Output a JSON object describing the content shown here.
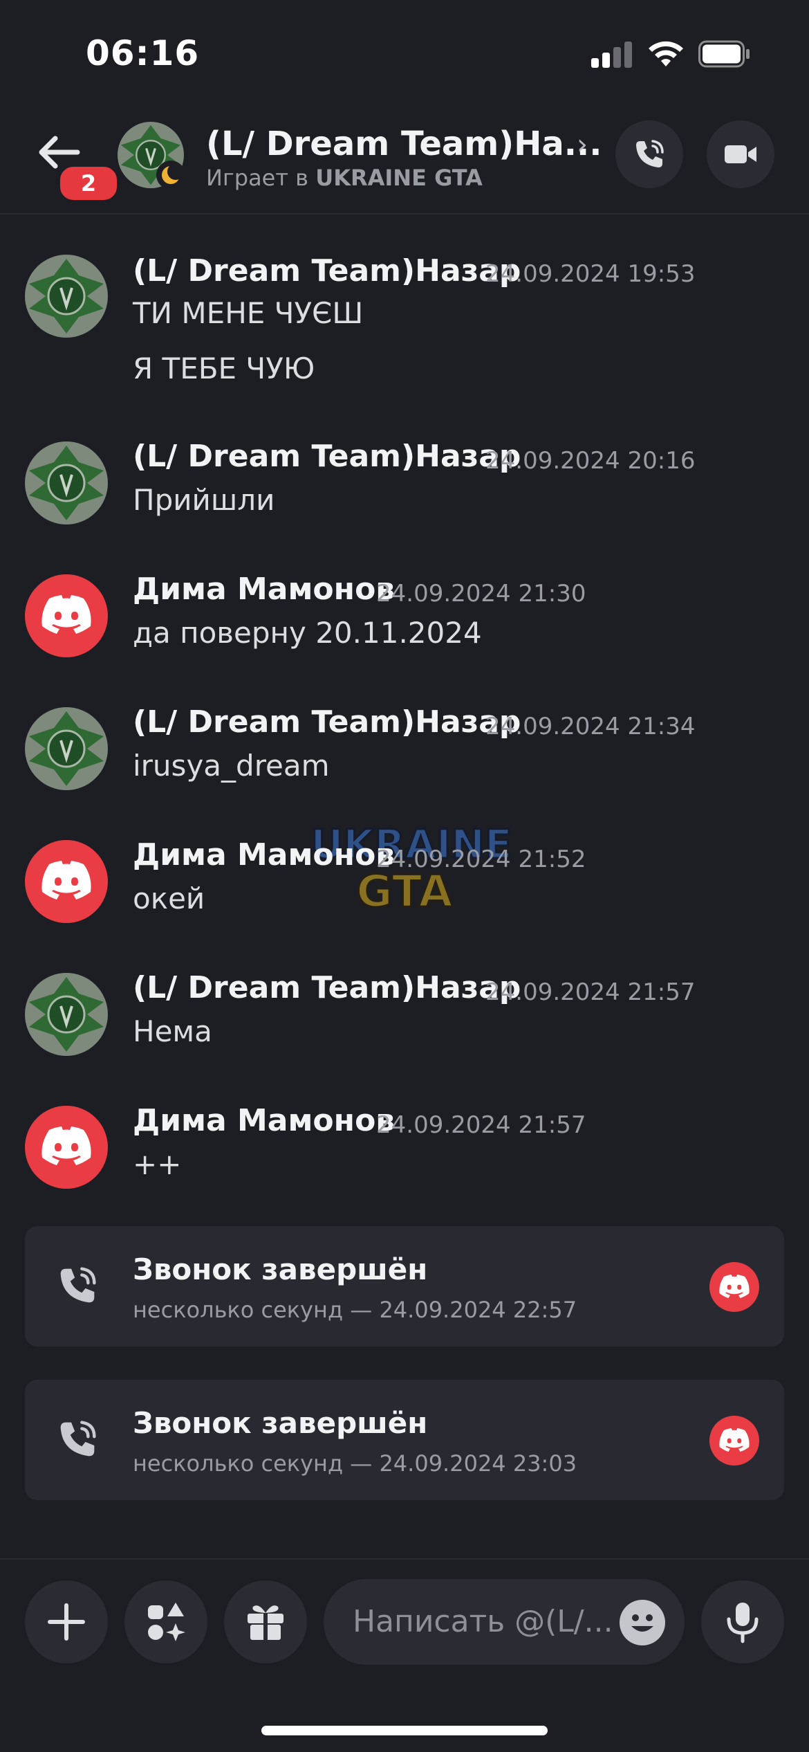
{
  "status_bar": {
    "time": "06:16"
  },
  "header": {
    "back_badge": "2",
    "title": "(L/ Dream Team)На...",
    "chevron": "›",
    "subtitle_prefix": "Играет в",
    "subtitle_game": "UKRAINE GTA"
  },
  "messages": [
    {
      "author": "(L/ Dream Team)Назар",
      "timestamp": "24.09.2024 19:53",
      "lines": [
        "ТИ МЕНЕ ЧУЄШ",
        "Я ТЕБЕ ЧУЮ"
      ],
      "avatar": "emblem"
    },
    {
      "author": "(L/ Dream Team)Назар",
      "timestamp": "24.09.2024 20:16",
      "lines": [
        "Прийшли"
      ],
      "avatar": "emblem"
    },
    {
      "author": "Дима Мамонов",
      "timestamp": "24.09.2024 21:30",
      "lines": [
        "да поверну 20.11.2024"
      ],
      "avatar": "discord"
    },
    {
      "author": "(L/ Dream Team)Назар",
      "timestamp": "24.09.2024 21:34",
      "lines": [
        "irusya_dream"
      ],
      "avatar": "emblem"
    },
    {
      "author": "Дима Мамонов",
      "timestamp": "24.09.2024 21:52",
      "lines": [
        "окей"
      ],
      "avatar": "discord"
    },
    {
      "author": "(L/ Dream Team)Назар",
      "timestamp": "24.09.2024 21:57",
      "lines": [
        "Нема"
      ],
      "avatar": "emblem"
    },
    {
      "author": "Дима Мамонов",
      "timestamp": "24.09.2024 21:57",
      "lines": [
        "++"
      ],
      "avatar": "discord"
    }
  ],
  "calls": [
    {
      "title": "Звонок завершён",
      "detail": "несколько секунд — 24.09.2024 22:57"
    },
    {
      "title": "Звонок завершён",
      "detail": "несколько секунд — 24.09.2024 23:03"
    }
  ],
  "watermark": {
    "line1": "UKRAINE",
    "line2": "GTA"
  },
  "composer": {
    "placeholder": "Написать @(L/..."
  },
  "colors": {
    "background": "#1d1e23",
    "discord_red": "#ea3c44",
    "card": "#292a31",
    "muted": "#9a9ca3"
  }
}
